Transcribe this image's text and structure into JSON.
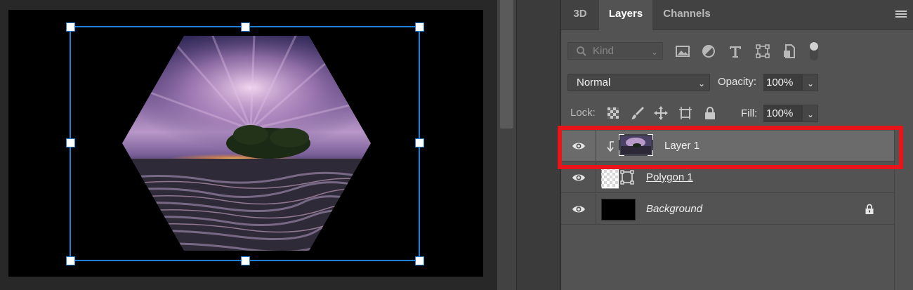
{
  "panel": {
    "tabs": [
      {
        "label": "3D"
      },
      {
        "label": "Layers"
      },
      {
        "label": "Channels"
      }
    ],
    "filter": {
      "kind_placeholder": "Kind",
      "icons": [
        "image-filter-icon",
        "adjustment-filter-icon",
        "type-filter-icon",
        "shape-filter-icon",
        "smart-object-filter-icon",
        "filter-toggle-icon"
      ]
    },
    "blend_mode": "Normal",
    "opacity_label": "Opacity:",
    "opacity_value": "100%",
    "lock_label": "Lock:",
    "fill_label": "Fill:",
    "fill_value": "100%",
    "layers": [
      {
        "name": "Layer 1",
        "selected": true,
        "clipped": true
      },
      {
        "name": "Polygon 1",
        "selected": false,
        "clipped": false
      },
      {
        "name": "Background",
        "selected": false,
        "locked": true
      }
    ]
  },
  "colors": {
    "selection_handle": "#1f7fd6",
    "highlight": "#e8141a",
    "panel_bg": "#535353"
  }
}
